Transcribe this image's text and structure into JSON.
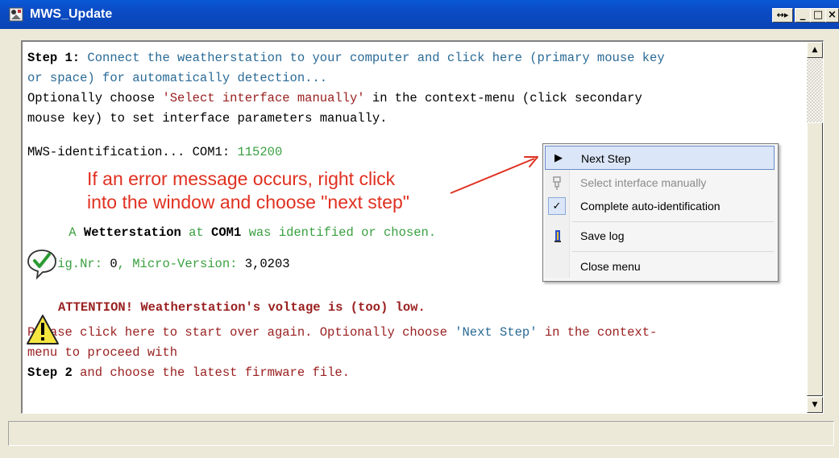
{
  "window": {
    "title": "MWS_Update",
    "controls": {
      "special": "↔▸",
      "minimize": "_",
      "maximize": "□",
      "close": "×"
    }
  },
  "content": {
    "step1_label": "Step 1:",
    "step1_text_a": " Connect the weatherstation to your computer and click here (primary mouse key",
    "step1_text_b": "or space) for automatically detection...",
    "optional_a1": "Optionally choose ",
    "optional_a2": "'Select interface manually'",
    "optional_a3": " in the context-menu (click secondary",
    "optional_b": "mouse key) to set interface parameters manually.",
    "mws_id": "MWS-identification... COM1: ",
    "baud": "115200",
    "ident_a": " A ",
    "ident_station": "Wetterstation",
    "ident_at": " at ",
    "ident_port": "COM1",
    "ident_end": " was identified or chosen.",
    "config_label": "Config.Nr: ",
    "config_value": "0",
    "micro_label": ", Micro-Version: ",
    "micro_value": "3,0203",
    "attention": "ATTENTION! Weatherstation's voltage is (too) low.",
    "please_a": "Please click here to start over again. Optionally choose ",
    "please_next": "'Next Step'",
    "please_b": " in the context-",
    "menu_proceed": "menu to proceed with",
    "step2_label": "Step 2",
    "step2_text": " and choose the latest firmware file."
  },
  "annotation": {
    "line1": "If an error message occurs, right click",
    "line2": "into the window and choose \"next step\""
  },
  "context_menu": {
    "items": [
      {
        "label": "Next Step",
        "icon": "play-arrow-icon",
        "state": "highlighted"
      },
      {
        "label": "Select interface manually",
        "icon": "plug-icon",
        "state": "disabled"
      },
      {
        "label": "Complete auto-identification",
        "icon": "checkmark-icon",
        "state": "checked"
      },
      {
        "label": "Save log",
        "icon": "save-log-icon",
        "state": "normal"
      },
      {
        "label": "Close menu",
        "icon": "",
        "state": "normal"
      }
    ]
  },
  "colors": {
    "titlebar": "#0b4bc4",
    "link_blue": "#2a6a96",
    "success_green": "#3aa040",
    "warning_red": "#9a2020",
    "annotation_red": "#e03020"
  }
}
